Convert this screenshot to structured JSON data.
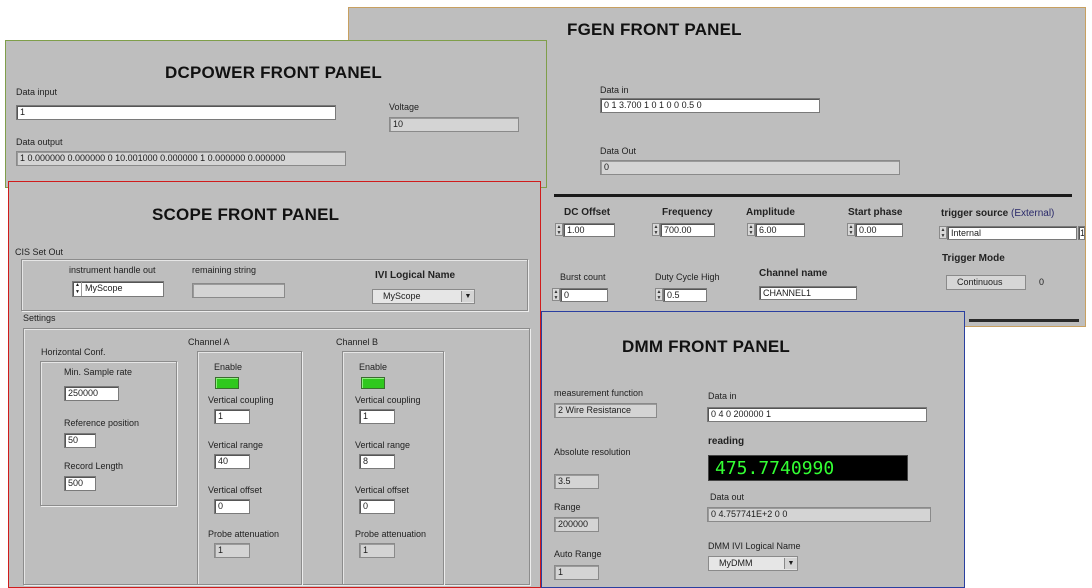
{
  "fgen": {
    "title": "FGEN FRONT PANEL",
    "data_in_label": "Data in",
    "data_in_value": "0 1 3.700 1 0 1 0 0 0.5 0",
    "data_out_label": "Data Out",
    "data_out_value": "0",
    "dc_offset_label": "DC Offset",
    "dc_offset_value": "1.00",
    "frequency_label": "Frequency",
    "frequency_value": "700.00",
    "amplitude_label": "Amplitude",
    "amplitude_value": "6.00",
    "start_phase_label": "Start phase",
    "start_phase_value": "0.00",
    "trigger_source_label": "trigger source",
    "trigger_source_suffix": "(External)",
    "trigger_source_value": "Internal",
    "trigger_source_index": "1",
    "burst_count_label": "Burst count",
    "burst_count_value": "0",
    "duty_cycle_label": "Duty Cycle High",
    "duty_cycle_value": "0.5",
    "channel_name_label": "Channel name",
    "channel_name_value": "CHANNEL1",
    "trigger_mode_label": "Trigger Mode",
    "trigger_mode_value": "Continuous",
    "trigger_mode_index": "0"
  },
  "dcpower": {
    "title": "DCPOWER FRONT PANEL",
    "data_input_label": "Data input",
    "data_input_value": "1",
    "voltage_label": "Voltage",
    "voltage_value": "10",
    "data_output_label": "Data output",
    "data_output_value": "1 0.000000 0.000000 0 10.001000 0.000000 1 0.000000 0.000000"
  },
  "scope": {
    "title": "SCOPE FRONT PANEL",
    "cis_label": "CIS Set Out",
    "handle_label": "instrument handle out",
    "handle_value": "MyScope",
    "remaining_label": "remaining string",
    "remaining_value": "",
    "ivi_label": "IVI Logical Name",
    "ivi_value": "MyScope",
    "settings_label": "Settings",
    "horiz_label": "Horizontal Conf.",
    "min_sample_label": "Min. Sample rate",
    "min_sample_value": "250000",
    "ref_pos_label": "Reference position",
    "ref_pos_value": "50",
    "rec_len_label": "Record Length",
    "rec_len_value": "500",
    "channel_a": {
      "title": "Channel A",
      "enable_label": "Enable",
      "coupling_label": "Vertical coupling",
      "coupling_value": "1",
      "range_label": "Vertical range",
      "range_value": "40",
      "offset_label": "Vertical offset",
      "offset_value": "0",
      "probe_label": "Probe attenuation",
      "probe_value": "1"
    },
    "channel_b": {
      "title": "Channel B",
      "enable_label": "Enable",
      "coupling_label": "Vertical coupling",
      "coupling_value": "1",
      "range_label": "Vertical range",
      "range_value": "8",
      "offset_label": "Vertical offset",
      "offset_value": "0",
      "probe_label": "Probe attenuation",
      "probe_value": "1"
    }
  },
  "dmm": {
    "title": "DMM FRONT PANEL",
    "function_label": "measurement function",
    "function_value": "2 Wire Resistance",
    "data_in_label": "Data in",
    "data_in_value": "0 4 0 200000 1",
    "reading_label": "reading",
    "reading_value": "475.7740990",
    "abs_res_label": "Absolute resolution",
    "abs_res_value": "3.5",
    "data_out_label": "Data out",
    "data_out_value": "0 4.757741E+2 0 0",
    "range_label": "Range",
    "range_value": "200000",
    "auto_range_label": "Auto Range",
    "auto_range_value": "1",
    "ivi_label": "DMM IVI Logical Name",
    "ivi_value": "MyDMM"
  },
  "colors": {
    "panel_bg": "#bebebe",
    "fgen_border": "#c8a060",
    "dcpower_border": "#7f9e4a",
    "scope_border": "#d01c1c",
    "dmm_border": "#2a3fa0",
    "reading_bg": "#000000",
    "reading_fg": "#33ff33",
    "led_on": "#2fc81d"
  }
}
